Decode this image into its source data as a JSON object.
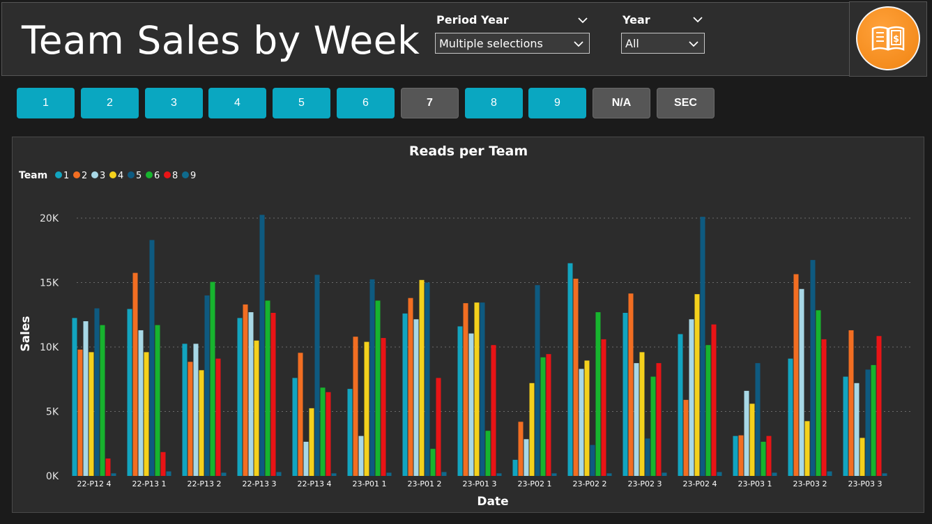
{
  "header": {
    "title": "Team Sales by Week",
    "filters": {
      "period_year": {
        "label": "Period Year",
        "value": "Multiple selections"
      },
      "year": {
        "label": "Year",
        "value": "All"
      }
    },
    "logo_icon": "book-dollar-icon"
  },
  "team_buttons": [
    {
      "label": "1",
      "active": true
    },
    {
      "label": "2",
      "active": true
    },
    {
      "label": "3",
      "active": true
    },
    {
      "label": "4",
      "active": true
    },
    {
      "label": "5",
      "active": true
    },
    {
      "label": "6",
      "active": true
    },
    {
      "label": "7",
      "active": false
    },
    {
      "label": "8",
      "active": true
    },
    {
      "label": "9",
      "active": true
    },
    {
      "label": "N/A",
      "active": false
    },
    {
      "label": "SEC",
      "active": false
    }
  ],
  "colors": {
    "accent": "#0aa7c1",
    "inactive": "#565656",
    "logo": "#f59a2a"
  },
  "chart_data": {
    "type": "bar",
    "title": "Reads per Team",
    "xlabel": "Date",
    "ylabel": "Sales",
    "ylim": [
      0,
      20000
    ],
    "yticks": [
      0,
      5000,
      10000,
      15000,
      20000
    ],
    "ytick_labels": [
      "0K",
      "5K",
      "10K",
      "15K",
      "20K"
    ],
    "grid": true,
    "legend": {
      "title": "Team",
      "position": "top-left"
    },
    "categories": [
      "22-P12 4",
      "22-P13 1",
      "22-P13 2",
      "22-P13 3",
      "22-P13 4",
      "23-P01 1",
      "23-P01 2",
      "23-P01 3",
      "23-P02 1",
      "23-P02 2",
      "23-P02 3",
      "23-P02 4",
      "23-P03 1",
      "23-P03 2",
      "23-P03 3"
    ],
    "series": [
      {
        "name": "1",
        "color": "#12a4bf",
        "values": [
          12250,
          12950,
          10250,
          12250,
          7600,
          6750,
          12600,
          11600,
          1250,
          16500,
          12650,
          11000,
          3100,
          9100,
          7700
        ]
      },
      {
        "name": "2",
        "color": "#f26e22",
        "values": [
          9800,
          15750,
          8850,
          13300,
          9550,
          10800,
          13800,
          13400,
          4200,
          15300,
          14150,
          5900,
          3150,
          15650,
          11300
        ]
      },
      {
        "name": "3",
        "color": "#a8d8e6",
        "values": [
          12000,
          11300,
          10250,
          12700,
          2650,
          3100,
          12150,
          11050,
          2850,
          8300,
          8750,
          12150,
          6600,
          14500,
          7200
        ]
      },
      {
        "name": "4",
        "color": "#f4d11c",
        "values": [
          9600,
          9600,
          8200,
          10500,
          5250,
          10400,
          15200,
          13450,
          7200,
          8950,
          9600,
          14100,
          5600,
          4250,
          2950
        ]
      },
      {
        "name": "5",
        "color": "#0e5a80",
        "values": [
          13000,
          18300,
          14000,
          20250,
          15600,
          15250,
          15000,
          13450,
          14800,
          2400,
          2900,
          20100,
          8750,
          16750,
          8250
        ]
      },
      {
        "name": "6",
        "color": "#17b42e",
        "values": [
          11700,
          11700,
          15050,
          13600,
          6850,
          13600,
          2100,
          3500,
          9200,
          12700,
          7700,
          10150,
          2650,
          12850,
          8600
        ]
      },
      {
        "name": "8",
        "color": "#e81416",
        "values": [
          1350,
          1850,
          9100,
          12650,
          6500,
          10700,
          7600,
          10150,
          9450,
          10600,
          8750,
          11750,
          3100,
          10600,
          10850
        ]
      },
      {
        "name": "9",
        "color": "#0f6a8c",
        "values": [
          200,
          350,
          250,
          300,
          200,
          250,
          300,
          200,
          200,
          200,
          250,
          300,
          250,
          350,
          200
        ]
      }
    ]
  }
}
